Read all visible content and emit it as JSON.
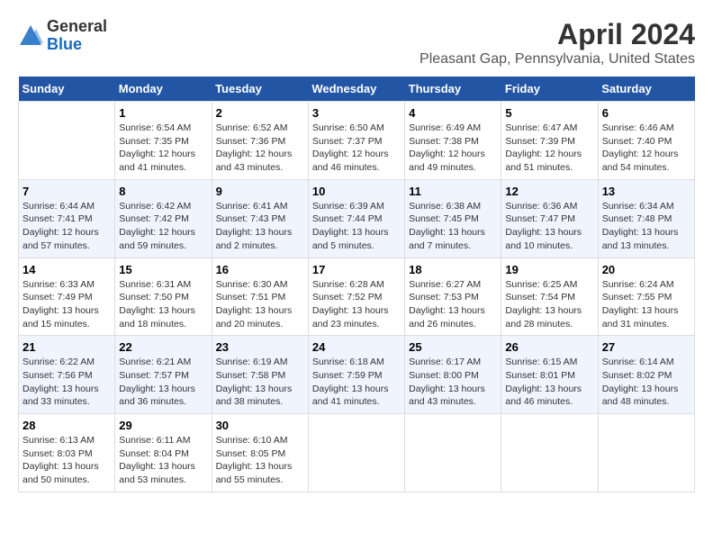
{
  "header": {
    "logo_line1": "General",
    "logo_line2": "Blue",
    "main_title": "April 2024",
    "subtitle": "Pleasant Gap, Pennsylvania, United States"
  },
  "days_of_week": [
    "Sunday",
    "Monday",
    "Tuesday",
    "Wednesday",
    "Thursday",
    "Friday",
    "Saturday"
  ],
  "weeks": [
    [
      {
        "day": "",
        "sunrise": "",
        "sunset": "",
        "daylight": ""
      },
      {
        "day": "1",
        "sunrise": "Sunrise: 6:54 AM",
        "sunset": "Sunset: 7:35 PM",
        "daylight": "Daylight: 12 hours and 41 minutes."
      },
      {
        "day": "2",
        "sunrise": "Sunrise: 6:52 AM",
        "sunset": "Sunset: 7:36 PM",
        "daylight": "Daylight: 12 hours and 43 minutes."
      },
      {
        "day": "3",
        "sunrise": "Sunrise: 6:50 AM",
        "sunset": "Sunset: 7:37 PM",
        "daylight": "Daylight: 12 hours and 46 minutes."
      },
      {
        "day": "4",
        "sunrise": "Sunrise: 6:49 AM",
        "sunset": "Sunset: 7:38 PM",
        "daylight": "Daylight: 12 hours and 49 minutes."
      },
      {
        "day": "5",
        "sunrise": "Sunrise: 6:47 AM",
        "sunset": "Sunset: 7:39 PM",
        "daylight": "Daylight: 12 hours and 51 minutes."
      },
      {
        "day": "6",
        "sunrise": "Sunrise: 6:46 AM",
        "sunset": "Sunset: 7:40 PM",
        "daylight": "Daylight: 12 hours and 54 minutes."
      }
    ],
    [
      {
        "day": "7",
        "sunrise": "Sunrise: 6:44 AM",
        "sunset": "Sunset: 7:41 PM",
        "daylight": "Daylight: 12 hours and 57 minutes."
      },
      {
        "day": "8",
        "sunrise": "Sunrise: 6:42 AM",
        "sunset": "Sunset: 7:42 PM",
        "daylight": "Daylight: 12 hours and 59 minutes."
      },
      {
        "day": "9",
        "sunrise": "Sunrise: 6:41 AM",
        "sunset": "Sunset: 7:43 PM",
        "daylight": "Daylight: 13 hours and 2 minutes."
      },
      {
        "day": "10",
        "sunrise": "Sunrise: 6:39 AM",
        "sunset": "Sunset: 7:44 PM",
        "daylight": "Daylight: 13 hours and 5 minutes."
      },
      {
        "day": "11",
        "sunrise": "Sunrise: 6:38 AM",
        "sunset": "Sunset: 7:45 PM",
        "daylight": "Daylight: 13 hours and 7 minutes."
      },
      {
        "day": "12",
        "sunrise": "Sunrise: 6:36 AM",
        "sunset": "Sunset: 7:47 PM",
        "daylight": "Daylight: 13 hours and 10 minutes."
      },
      {
        "day": "13",
        "sunrise": "Sunrise: 6:34 AM",
        "sunset": "Sunset: 7:48 PM",
        "daylight": "Daylight: 13 hours and 13 minutes."
      }
    ],
    [
      {
        "day": "14",
        "sunrise": "Sunrise: 6:33 AM",
        "sunset": "Sunset: 7:49 PM",
        "daylight": "Daylight: 13 hours and 15 minutes."
      },
      {
        "day": "15",
        "sunrise": "Sunrise: 6:31 AM",
        "sunset": "Sunset: 7:50 PM",
        "daylight": "Daylight: 13 hours and 18 minutes."
      },
      {
        "day": "16",
        "sunrise": "Sunrise: 6:30 AM",
        "sunset": "Sunset: 7:51 PM",
        "daylight": "Daylight: 13 hours and 20 minutes."
      },
      {
        "day": "17",
        "sunrise": "Sunrise: 6:28 AM",
        "sunset": "Sunset: 7:52 PM",
        "daylight": "Daylight: 13 hours and 23 minutes."
      },
      {
        "day": "18",
        "sunrise": "Sunrise: 6:27 AM",
        "sunset": "Sunset: 7:53 PM",
        "daylight": "Daylight: 13 hours and 26 minutes."
      },
      {
        "day": "19",
        "sunrise": "Sunrise: 6:25 AM",
        "sunset": "Sunset: 7:54 PM",
        "daylight": "Daylight: 13 hours and 28 minutes."
      },
      {
        "day": "20",
        "sunrise": "Sunrise: 6:24 AM",
        "sunset": "Sunset: 7:55 PM",
        "daylight": "Daylight: 13 hours and 31 minutes."
      }
    ],
    [
      {
        "day": "21",
        "sunrise": "Sunrise: 6:22 AM",
        "sunset": "Sunset: 7:56 PM",
        "daylight": "Daylight: 13 hours and 33 minutes."
      },
      {
        "day": "22",
        "sunrise": "Sunrise: 6:21 AM",
        "sunset": "Sunset: 7:57 PM",
        "daylight": "Daylight: 13 hours and 36 minutes."
      },
      {
        "day": "23",
        "sunrise": "Sunrise: 6:19 AM",
        "sunset": "Sunset: 7:58 PM",
        "daylight": "Daylight: 13 hours and 38 minutes."
      },
      {
        "day": "24",
        "sunrise": "Sunrise: 6:18 AM",
        "sunset": "Sunset: 7:59 PM",
        "daylight": "Daylight: 13 hours and 41 minutes."
      },
      {
        "day": "25",
        "sunrise": "Sunrise: 6:17 AM",
        "sunset": "Sunset: 8:00 PM",
        "daylight": "Daylight: 13 hours and 43 minutes."
      },
      {
        "day": "26",
        "sunrise": "Sunrise: 6:15 AM",
        "sunset": "Sunset: 8:01 PM",
        "daylight": "Daylight: 13 hours and 46 minutes."
      },
      {
        "day": "27",
        "sunrise": "Sunrise: 6:14 AM",
        "sunset": "Sunset: 8:02 PM",
        "daylight": "Daylight: 13 hours and 48 minutes."
      }
    ],
    [
      {
        "day": "28",
        "sunrise": "Sunrise: 6:13 AM",
        "sunset": "Sunset: 8:03 PM",
        "daylight": "Daylight: 13 hours and 50 minutes."
      },
      {
        "day": "29",
        "sunrise": "Sunrise: 6:11 AM",
        "sunset": "Sunset: 8:04 PM",
        "daylight": "Daylight: 13 hours and 53 minutes."
      },
      {
        "day": "30",
        "sunrise": "Sunrise: 6:10 AM",
        "sunset": "Sunset: 8:05 PM",
        "daylight": "Daylight: 13 hours and 55 minutes."
      },
      {
        "day": "",
        "sunrise": "",
        "sunset": "",
        "daylight": ""
      },
      {
        "day": "",
        "sunrise": "",
        "sunset": "",
        "daylight": ""
      },
      {
        "day": "",
        "sunrise": "",
        "sunset": "",
        "daylight": ""
      },
      {
        "day": "",
        "sunrise": "",
        "sunset": "",
        "daylight": ""
      }
    ]
  ]
}
